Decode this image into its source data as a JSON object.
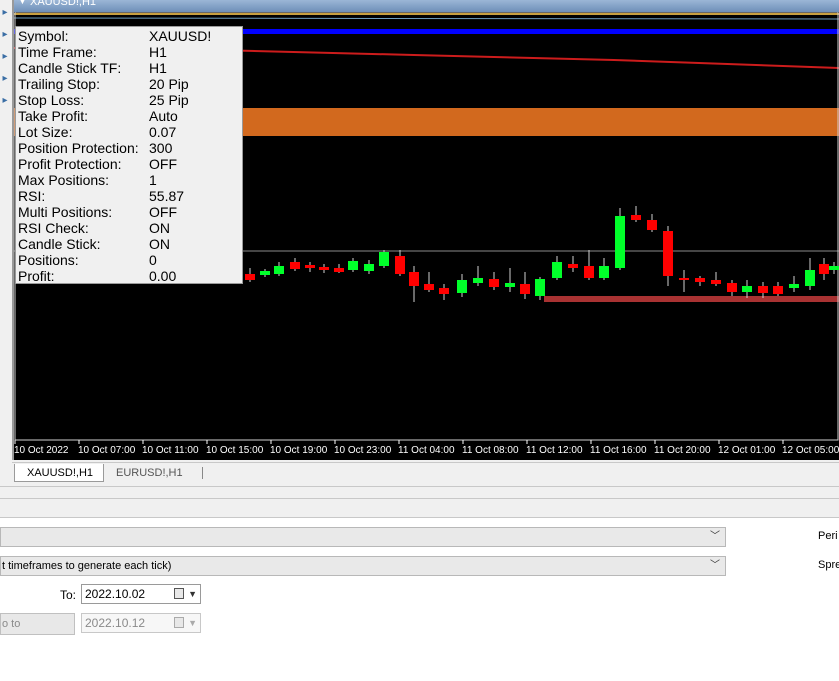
{
  "chart_window": {
    "title": "XAUUSD!,H1",
    "time_axis": [
      "10 Oct 2022",
      "10 Oct 07:00",
      "10 Oct 11:00",
      "10 Oct 15:00",
      "10 Oct 19:00",
      "10 Oct 23:00",
      "11 Oct 04:00",
      "11 Oct 08:00",
      "11 Oct 12:00",
      "11 Oct 16:00",
      "11 Oct 20:00",
      "12 Oct 01:00",
      "12 Oct 05:00"
    ]
  },
  "info_panel": {
    "rows": [
      {
        "label": "Symbol:",
        "value": "XAUUSD!"
      },
      {
        "label": "Time Frame:",
        "value": "H1"
      },
      {
        "label": "Candle Stick TF:",
        "value": "H1"
      },
      {
        "label": "Trailing Stop:",
        "value": "20 Pip"
      },
      {
        "label": "Stop Loss:",
        "value": "25 Pip"
      },
      {
        "label": "Take Profit:",
        "value": "Auto"
      },
      {
        "label": "Lot Size:",
        "value": "0.07"
      },
      {
        "label": "Position Protection:",
        "value": "300"
      },
      {
        "label": "Profit Protection:",
        "value": "OFF"
      },
      {
        "label": "Max Positions:",
        "value": "1"
      },
      {
        "label": "RSI:",
        "value": "55.87"
      },
      {
        "label": "Multi Positions:",
        "value": "OFF"
      },
      {
        "label": "RSI Check:",
        "value": "ON"
      },
      {
        "label": "Candle Stick:",
        "value": "ON"
      },
      {
        "label": "Positions:",
        "value": "0"
      },
      {
        "label": "Profit:",
        "value": "0.00"
      }
    ]
  },
  "tabs": [
    {
      "label": "XAUUSD!,H1",
      "active": true
    },
    {
      "label": "EURUSD!,H1",
      "active": false
    }
  ],
  "tester": {
    "model_text": "",
    "tick_mode_text": "t timeframes to generate each tick)",
    "period_label": "Peri",
    "spread_label": "Spre",
    "to_label": "To:",
    "to_date": "2022.10.02",
    "skip_to_label": "o to",
    "skip_to_date": "2022.10.12"
  },
  "colors": {
    "bull_candle": "#00ff2a",
    "bear_candle": "#ff0000",
    "orange_band": "#d2691e",
    "blue_line": "#0000ff",
    "red_line": "#cc1c1c",
    "stop_bar": "#a83232",
    "gold_line": "#c8a040"
  },
  "icons": {
    "title_chevron": "chevron-down-icon",
    "calendar": "calendar-icon",
    "dropdown": "dropdown-arrow-icon"
  }
}
